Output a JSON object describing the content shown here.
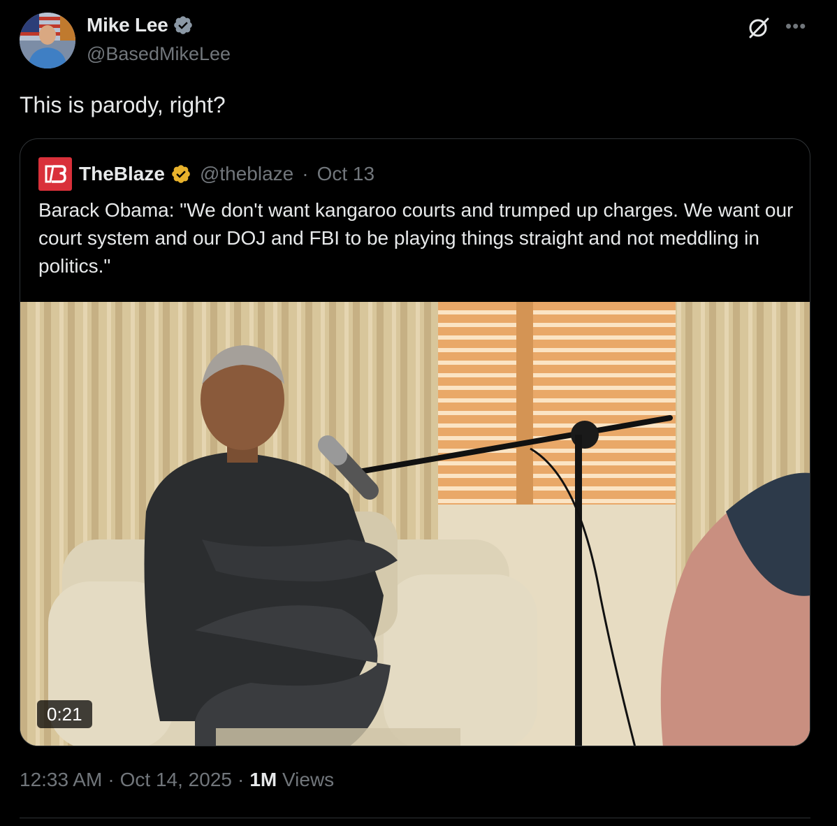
{
  "author": {
    "name": "Mike Lee",
    "handle": "@BasedMikeLee",
    "avatar_icon": "profile-photo",
    "verified_color": "#8b98a5"
  },
  "tweet": {
    "text": "This is parody, right?"
  },
  "quoted": {
    "name": "TheBlaze",
    "handle": "@theblaze",
    "separator": "·",
    "date": "Oct 13",
    "logo_color": "#d9303a",
    "verified_color": "#e8b22c",
    "text": "Barack Obama: \"We don't want kangaroo courts and trumped up charges. We want our court system and our DOJ and FBI to be playing things straight and not meddling in politics.\"",
    "video": {
      "duration": "0:21"
    }
  },
  "footer": {
    "time": "12:33 AM",
    "separator": "·",
    "date": "Oct 14, 2025",
    "views_count": "1M",
    "views_label": "Views"
  },
  "icons": {
    "grok": "grok-icon",
    "more": "more-icon"
  },
  "colors": {
    "background": "#000000",
    "text_primary": "#e7e9ea",
    "text_secondary": "#71767b",
    "border": "#2f3336"
  }
}
